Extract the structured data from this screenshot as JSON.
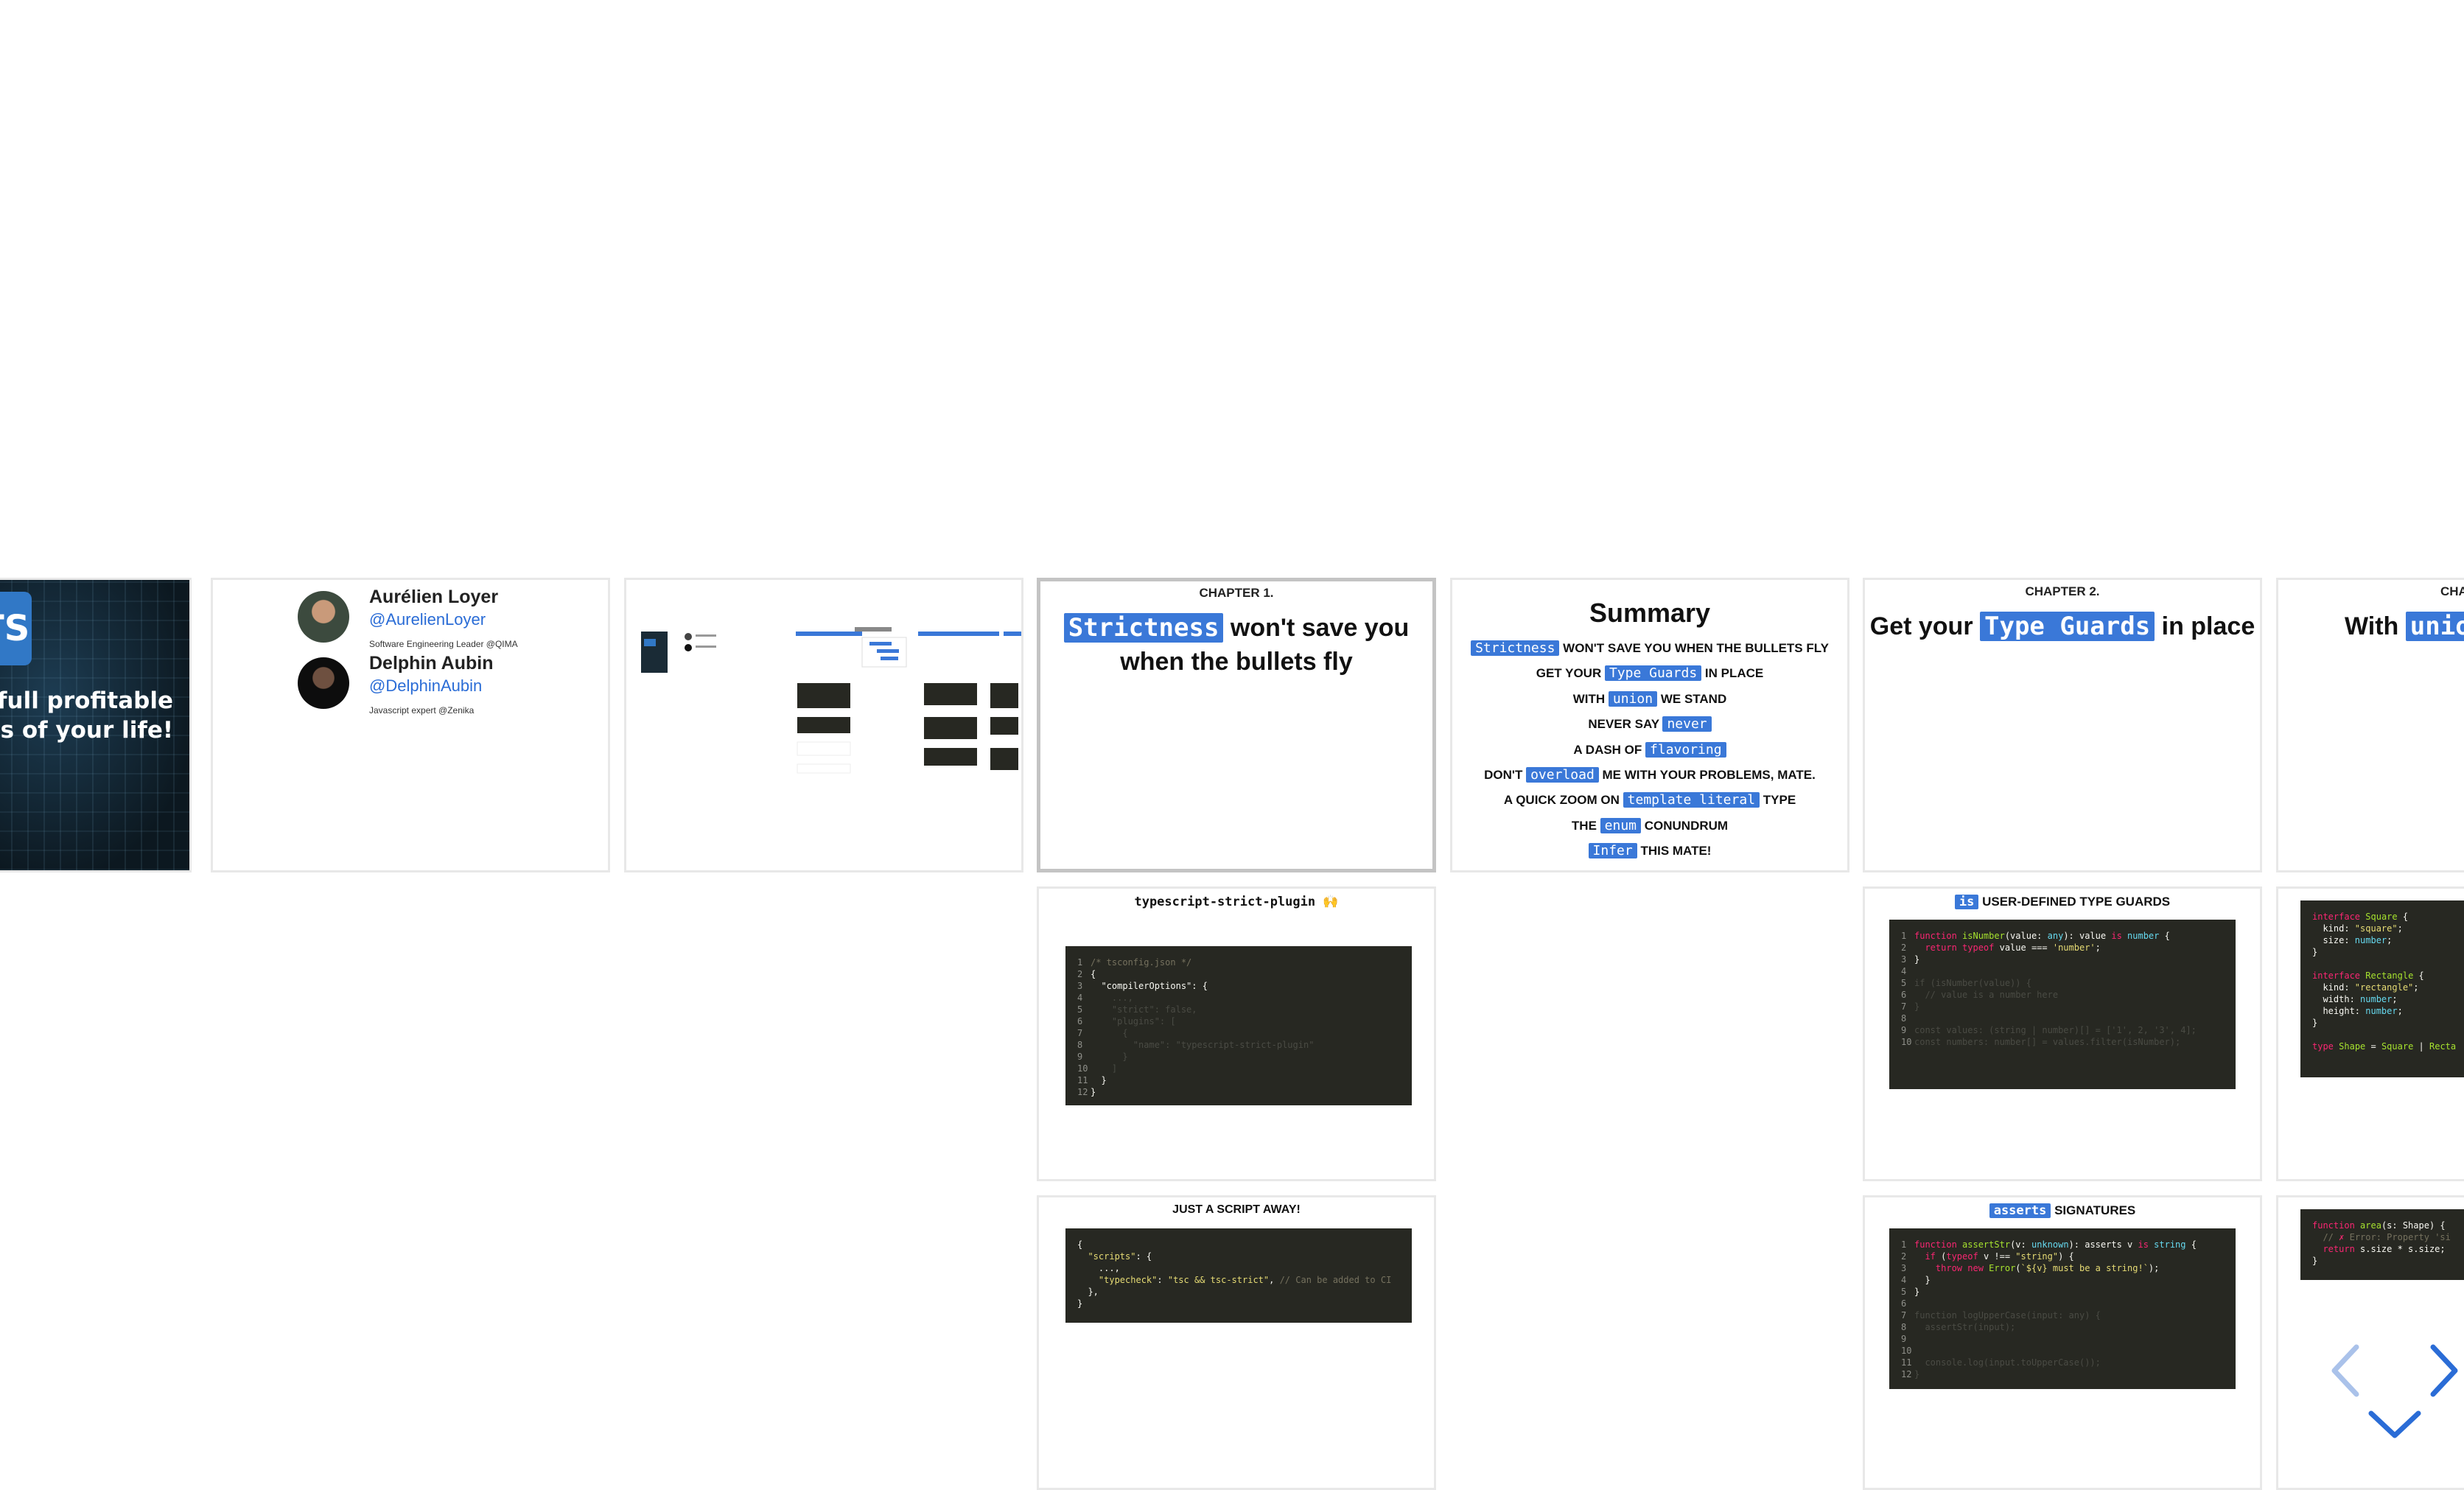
{
  "cover": {
    "badge": "TS",
    "line1": "nfull profitable",
    "line2": "tes of your life!"
  },
  "authors": [
    {
      "name": "Aurélien Loyer",
      "handle": "@AurelienLoyer",
      "role": "Software Engineering Leader @QIMA"
    },
    {
      "name": "Delphin Aubin",
      "handle": "@DelphinAubin",
      "role": "Javascript expert @Zenika"
    }
  ],
  "chapter1": {
    "label": "CHAPTER 1.",
    "highlight": "Strictness",
    "rest1": " won't save you",
    "rest2": "when the bullets fly"
  },
  "summary": {
    "title": "Summary",
    "items": [
      {
        "pre": "",
        "hl": "Strictness",
        "post": " WON'T SAVE YOU WHEN THE BULLETS FLY"
      },
      {
        "pre": "GET YOUR ",
        "hl": "Type Guards",
        "post": " IN PLACE"
      },
      {
        "pre": "WITH ",
        "hl": "union",
        "post": " WE STAND"
      },
      {
        "pre": "NEVER SAY ",
        "hl": "never",
        "post": ""
      },
      {
        "pre": "A DASH OF ",
        "hl": "flavoring",
        "post": ""
      },
      {
        "pre": "DON'T ",
        "hl": "overload",
        "post": " ME WITH YOUR PROBLEMS, MATE."
      },
      {
        "pre": "A QUICK ZOOM ON ",
        "hl": "template literal",
        "post": " TYPE"
      },
      {
        "pre": "THE ",
        "hl": "enum",
        "post": " CONUNDRUM"
      },
      {
        "pre": "",
        "hl": "Infer",
        "post": " THIS MATE!"
      }
    ]
  },
  "chapter2": {
    "label": "CHAPTER 2.",
    "pre": "Get your ",
    "highlight": "Type Guards",
    "post": " in place"
  },
  "chapter3": {
    "label": "CHA",
    "pre": "With ",
    "highlight": "unio"
  },
  "strict_plugin": {
    "title": "typescript-strict-plugin 🙌"
  },
  "script_away": {
    "title": "JUST A SCRIPT AWAY!"
  },
  "user_guards": {
    "hl": "is",
    "title": " USER-DEFINED TYPE GUARDS"
  },
  "asserts": {
    "hl": "asserts",
    "title": " SIGNATURES"
  },
  "colors": {
    "accent": "#3a78d8",
    "code_bg": "#272822"
  },
  "nav": {
    "left": "chevron-left-icon",
    "right": "chevron-right-icon",
    "down": "chevron-down-icon"
  }
}
